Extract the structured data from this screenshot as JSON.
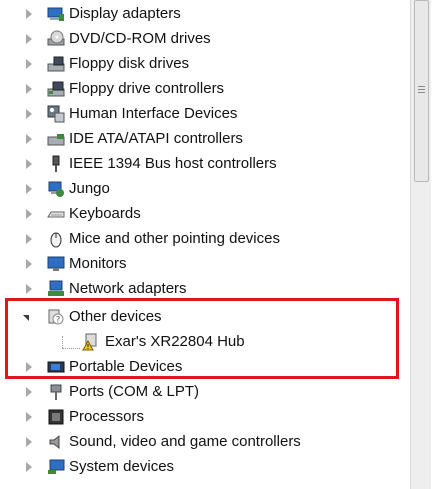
{
  "devices": [
    {
      "label": "Display adapters",
      "icon": "display-adapter-icon"
    },
    {
      "label": "DVD/CD-ROM drives",
      "icon": "dvd-drive-icon"
    },
    {
      "label": "Floppy disk drives",
      "icon": "floppy-disk-icon"
    },
    {
      "label": "Floppy drive controllers",
      "icon": "floppy-controller-icon"
    },
    {
      "label": "Human Interface Devices",
      "icon": "hid-icon"
    },
    {
      "label": "IDE ATA/ATAPI controllers",
      "icon": "ide-controller-icon"
    },
    {
      "label": "IEEE 1394 Bus host controllers",
      "icon": "firewire-icon"
    },
    {
      "label": "Jungo",
      "icon": "jungo-icon"
    },
    {
      "label": "Keyboards",
      "icon": "keyboard-icon"
    },
    {
      "label": "Mice and other pointing devices",
      "icon": "mouse-icon"
    },
    {
      "label": "Monitors",
      "icon": "monitor-icon"
    },
    {
      "label": "Network adapters",
      "icon": "network-adapter-icon"
    },
    {
      "label": "Other devices",
      "icon": "other-devices-icon",
      "expanded": true
    },
    {
      "label": "Exar's  XR22804 Hub",
      "icon": "warning-device-icon",
      "child": true
    },
    {
      "label": "Portable Devices",
      "icon": "portable-device-icon"
    },
    {
      "label": "Ports (COM & LPT)",
      "icon": "port-icon"
    },
    {
      "label": "Processors",
      "icon": "processor-icon"
    },
    {
      "label": "Sound, video and game controllers",
      "icon": "sound-icon"
    },
    {
      "label": "System devices",
      "icon": "system-devices-icon"
    }
  ],
  "colors": {
    "highlight": "#e3141b",
    "text": "#111111"
  }
}
